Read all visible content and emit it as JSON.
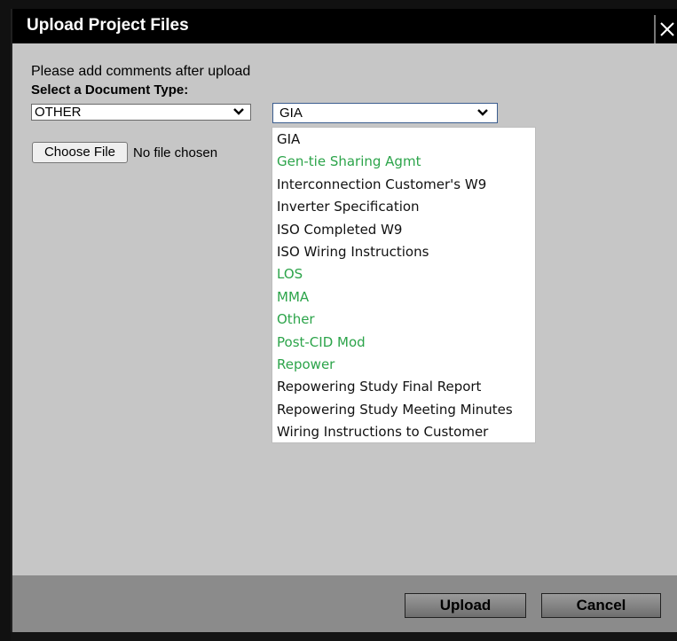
{
  "dialog": {
    "title": "Upload Project Files"
  },
  "instructions": "Please add comments after upload",
  "document_type_label": "Select a Document Type:",
  "category_select": {
    "value": "OTHER"
  },
  "subtype_select": {
    "value": "GIA",
    "options": [
      {
        "label": "GIA",
        "color": "#111111"
      },
      {
        "label": "Gen-tie Sharing Agmt",
        "color": "#2ca44a"
      },
      {
        "label": "Interconnection Customer's W9",
        "color": "#111111"
      },
      {
        "label": "Inverter Specification",
        "color": "#111111"
      },
      {
        "label": "ISO Completed W9",
        "color": "#111111"
      },
      {
        "label": "ISO Wiring Instructions",
        "color": "#111111"
      },
      {
        "label": "LOS",
        "color": "#2ca44a"
      },
      {
        "label": "MMA",
        "color": "#2ca44a"
      },
      {
        "label": "Other",
        "color": "#2ca44a"
      },
      {
        "label": "Post-CID Mod",
        "color": "#2ca44a"
      },
      {
        "label": "Repower",
        "color": "#2ca44a"
      },
      {
        "label": "Repowering Study Final Report",
        "color": "#111111"
      },
      {
        "label": "Repowering Study Meeting Minutes",
        "color": "#111111"
      },
      {
        "label": "Wiring Instructions to Customer",
        "color": "#111111"
      }
    ]
  },
  "file_input": {
    "button_label": "Choose File",
    "status": "No file chosen"
  },
  "footer": {
    "upload_label": "Upload",
    "cancel_label": "Cancel"
  },
  "icons": {
    "close": "close-icon",
    "chevron": "chevron-down-icon"
  }
}
